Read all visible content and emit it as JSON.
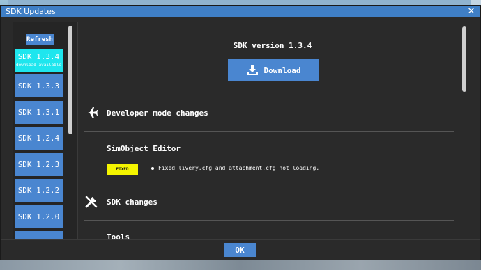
{
  "window": {
    "title": "SDK Updates",
    "close_glyph": "✕"
  },
  "sidebar": {
    "refresh_label": "Refresh",
    "versions": [
      {
        "label": "SDK 1.3.4",
        "sub": "download available",
        "active": true
      },
      {
        "label": "SDK 1.3.3"
      },
      {
        "label": "SDK 1.3.1"
      },
      {
        "label": "SDK 1.2.4"
      },
      {
        "label": "SDK 1.2.3"
      },
      {
        "label": "SDK 1.2.2"
      },
      {
        "label": "SDK 1.2.0"
      }
    ]
  },
  "content": {
    "version_title": "SDK version 1.3.4",
    "download_label": "Download",
    "sections": [
      {
        "title": "Developer mode changes",
        "icon": "airplane-icon"
      },
      {
        "title": "SDK changes",
        "icon": "tools-icon"
      }
    ],
    "subsections": [
      {
        "title": "SimObject Editor"
      },
      {
        "title": "Tools"
      }
    ],
    "changes": [
      {
        "badge": "FIXED",
        "text": "Fixed livery.cfg and attachment.cfg not loading."
      }
    ]
  },
  "footer": {
    "ok_label": "OK"
  },
  "colors": {
    "accent": "#4a86d0",
    "active": "#1ee6ee",
    "badge": "#f5f500",
    "titlebar": "#3f7fc6"
  }
}
